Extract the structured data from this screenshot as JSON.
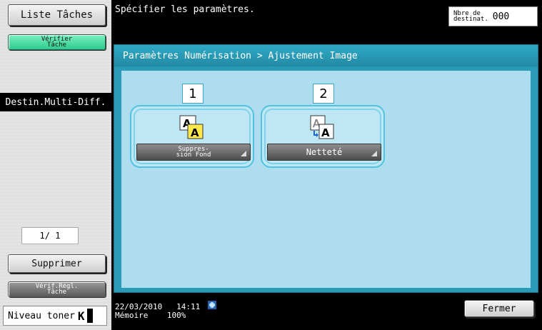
{
  "sidebar": {
    "liste_taches": "Liste Tâches",
    "verifier_tache": "Vérifier\nTâche",
    "destin_label": "Destin.Multi-Diff.",
    "page_counter": "1/ 1",
    "supprimer": "Supprimer",
    "verif_regl": "Vérif.Régl.\nTâche",
    "toner_label": "Niveau toner",
    "toner_letter": "K"
  },
  "header": {
    "instruction": "Spécifier les paramètres.",
    "dest_label": "Nbre de\ndestinat.",
    "dest_count": "000"
  },
  "panel": {
    "breadcrumb": "Paramètres Numérisation > Ajustement Image",
    "functions": [
      {
        "number": "1",
        "label": "Suppres-\nsion Fond",
        "icon": "background-removal-icon"
      },
      {
        "number": "2",
        "label": "Netteté",
        "icon": "sharpness-icon"
      }
    ]
  },
  "footer": {
    "date": "22/03/2010",
    "time": "14:11",
    "memory_label": "Mémoire",
    "memory_value": "100%",
    "status_icon": "network-status-icon",
    "close": "Fermer"
  },
  "colors": {
    "panel": "#2a9bb7",
    "panel_body": "#aeddef",
    "accent_green": "#2ec98e",
    "highlight_yellow": "#ffe84a"
  }
}
